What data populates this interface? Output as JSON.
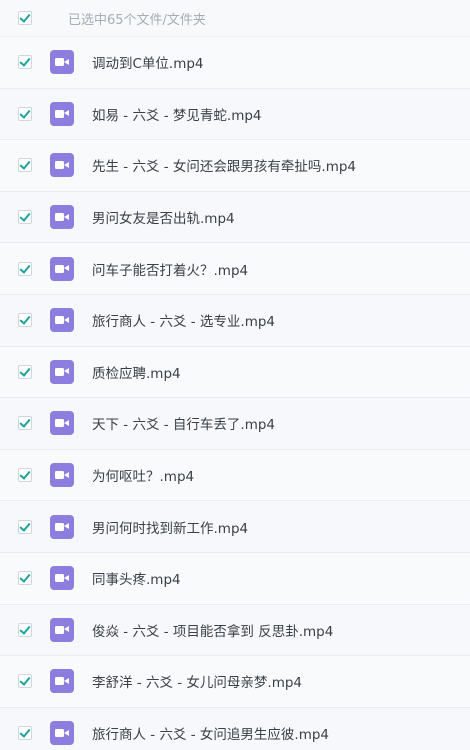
{
  "header": {
    "selection_text": "已选中65个文件/文件夹"
  },
  "files": [
    {
      "name": "调动到C单位.mp4",
      "selected": true
    },
    {
      "name": "如易 - 六爻 - 梦见青蛇.mp4",
      "selected": true
    },
    {
      "name": "先生 - 六爻 - 女问还会跟男孩有牵扯吗.mp4",
      "selected": true
    },
    {
      "name": "男问女友是否出轨.mp4",
      "selected": true
    },
    {
      "name": "问车子能否打着火？.mp4",
      "selected": true
    },
    {
      "name": "旅行商人 - 六爻 - 选专业.mp4",
      "selected": true
    },
    {
      "name": "质检应聘.mp4",
      "selected": true
    },
    {
      "name": "天下 - 六爻 - 自行车丢了.mp4",
      "selected": true
    },
    {
      "name": "为何呕吐？.mp4",
      "selected": true
    },
    {
      "name": "男问何时找到新工作.mp4",
      "selected": true
    },
    {
      "name": "同事头疼.mp4",
      "selected": true
    },
    {
      "name": "俊焱 - 六爻 - 项目能否拿到 反思卦.mp4",
      "selected": true
    },
    {
      "name": "李舒洋 - 六爻 - 女儿问母亲梦.mp4",
      "selected": true
    },
    {
      "name": "旅行商人 - 六爻 - 女问追男生应彼.mp4",
      "selected": true
    }
  ],
  "icons": {
    "checkbox": "checkbox-checked-icon",
    "file": "video-file-icon"
  },
  "colors": {
    "check": "#1aa39a",
    "video_icon": "#8d7ddf",
    "text": "#3b4046",
    "muted_text": "#a6adb6"
  }
}
